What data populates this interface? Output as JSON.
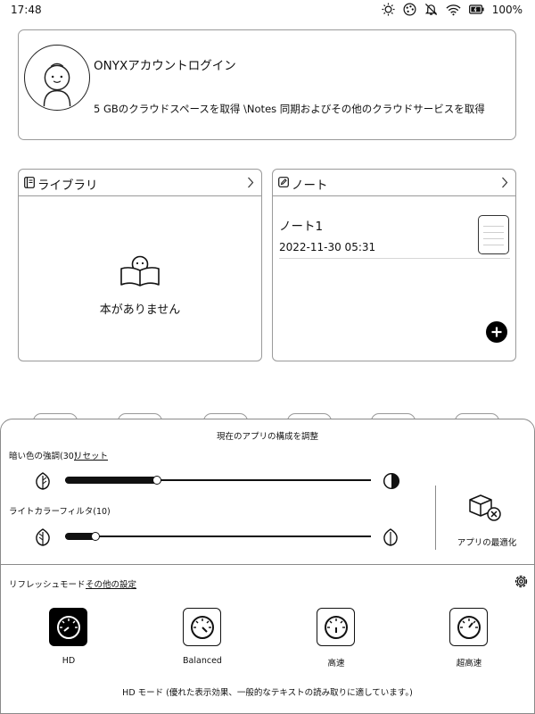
{
  "status_bar": {
    "time": "17:48",
    "icons": [
      "brightness-icon",
      "color-wheel-icon",
      "notification-off-icon",
      "wifi-icon",
      "battery-icon"
    ],
    "battery_percent": "100%"
  },
  "account": {
    "title": "ONYXアカウントログイン",
    "subtitle": "5 GBのクラウドスペースを取得 \\Notes 同期およびその他のクラウドサービスを取得"
  },
  "library": {
    "title": "ライブラリ",
    "empty_text": "本がありません"
  },
  "notes": {
    "title": "ノート",
    "items": [
      {
        "title": "ノート1",
        "date": "2022-11-30 05:31"
      }
    ]
  },
  "sheet": {
    "title": "現在のアプリの構成を調整",
    "dark_enhance_label": "暗い色の強調(30)",
    "reset_link": "リセット",
    "dark_enhance_value": 30,
    "light_filter_label": "ライトカラーフィルタ(10)",
    "light_filter_value": 10,
    "optimize_label": "アプリの最適化",
    "refresh_label": "リフレッシュモード",
    "more_settings_link": "その他の設定",
    "modes": [
      {
        "label": "HD",
        "selected": true
      },
      {
        "label": "Balanced",
        "selected": false
      },
      {
        "label": "高速",
        "selected": false
      },
      {
        "label": "超高速",
        "selected": false
      }
    ],
    "mode_description": "HD モード (優れた表示効果、一般的なテキストの読み取りに適しています。)"
  },
  "colors": {
    "selected": "#000000",
    "border": "#9a9a9a"
  }
}
